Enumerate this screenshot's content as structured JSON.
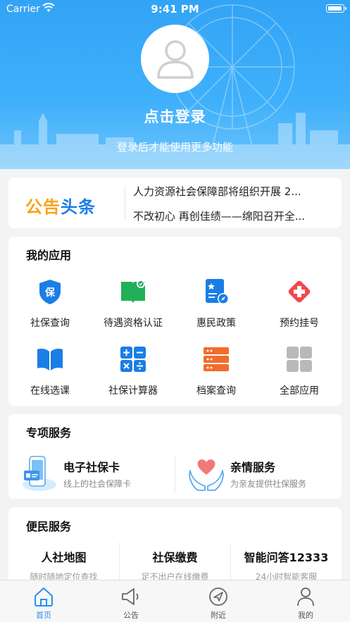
{
  "status_bar": {
    "carrier": "Carrier",
    "time": "9:41 PM"
  },
  "header": {
    "login_title": "点击登录",
    "login_subtitle": "登录后才能使用更多功能"
  },
  "notice": {
    "logo_part1": "公告",
    "logo_part2": "头条",
    "lines": [
      "人力资源社会保障部将组织开展 2...",
      "不改初心 再创佳绩——绵阳召开全..."
    ]
  },
  "my_apps": {
    "title": "我的应用",
    "items": [
      {
        "label": "社保查询",
        "icon": "shield-icon"
      },
      {
        "label": "待遇资格认证",
        "icon": "book-badge-icon"
      },
      {
        "label": "惠民政策",
        "icon": "policy-doc-icon"
      },
      {
        "label": "预约挂号",
        "icon": "medical-cross-icon"
      },
      {
        "label": "在线选课",
        "icon": "open-book-icon"
      },
      {
        "label": "社保计算器",
        "icon": "calculator-icon"
      },
      {
        "label": "档案查询",
        "icon": "archive-icon"
      },
      {
        "label": "全部应用",
        "icon": "grid-icon"
      }
    ]
  },
  "special_services": {
    "title": "专项服务",
    "items": [
      {
        "title": "电子社保卡",
        "subtitle": "线上的社会保障卡",
        "icon": "social-security-card-icon"
      },
      {
        "title": "亲情服务",
        "subtitle": "为亲友提供社保服务",
        "icon": "heart-hands-icon"
      }
    ]
  },
  "convenience": {
    "title": "便民服务",
    "items": [
      {
        "title": "人社地图",
        "subtitle": "随时随地定位查找"
      },
      {
        "title": "社保缴费",
        "subtitle": "足不出户在线缴费"
      },
      {
        "title": "智能问答12333",
        "subtitle": "24小时智能客服"
      }
    ]
  },
  "tabbar": {
    "items": [
      {
        "label": "首页",
        "icon": "home-icon",
        "active": true
      },
      {
        "label": "公告",
        "icon": "megaphone-icon",
        "active": false
      },
      {
        "label": "附近",
        "icon": "compass-icon",
        "active": false
      },
      {
        "label": "我的",
        "icon": "person-icon",
        "active": false
      }
    ]
  },
  "colors": {
    "header": "#3aa9f8",
    "accent": "#2b8ef0",
    "app_blue": "#1a7ee6",
    "app_red": "#f0484e",
    "app_orange": "#f36b2c",
    "app_gray": "#b9b9b9"
  }
}
